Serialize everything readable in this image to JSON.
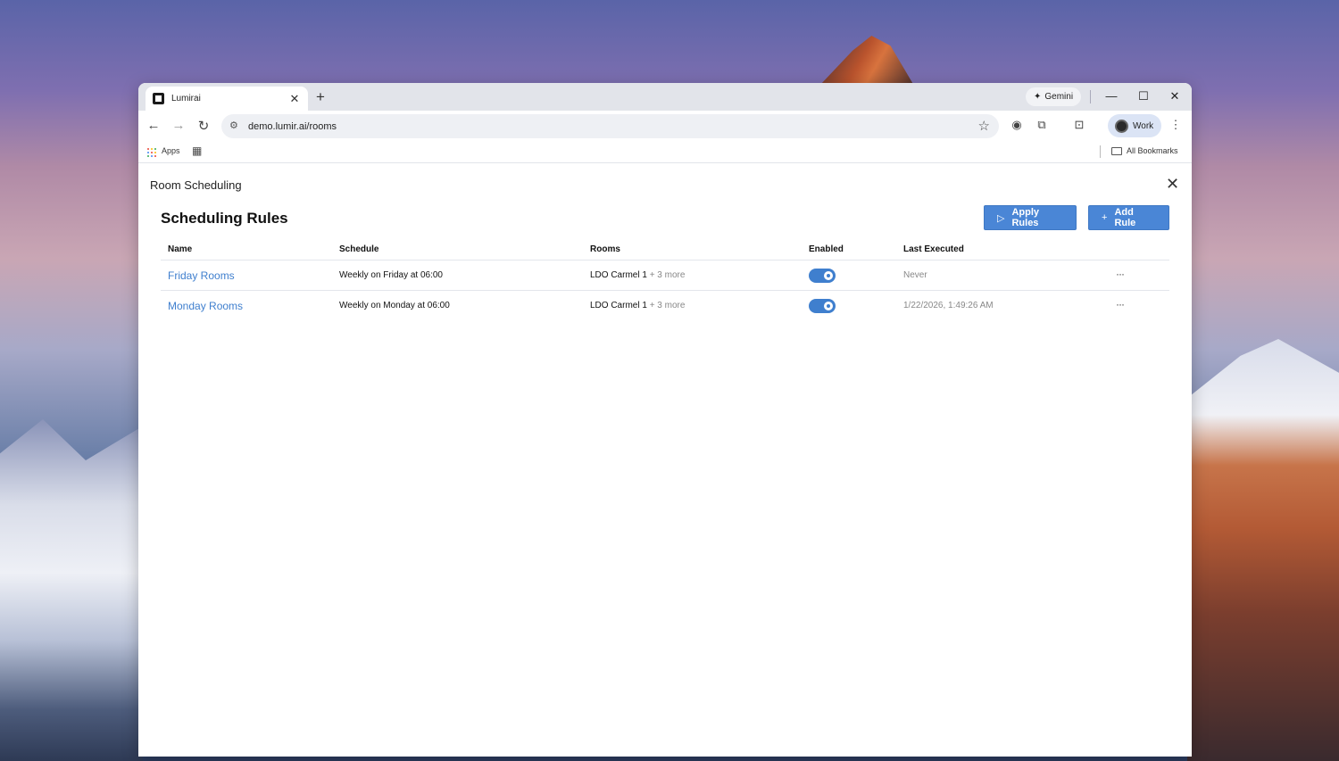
{
  "browser": {
    "tab_title": "Lumirai",
    "new_tab_icon": "plus-icon",
    "gemini_label": "Gemini",
    "url": "demo.lumir.ai/rooms",
    "profile_label": "Work",
    "bookmarks": {
      "apps_label": "Apps",
      "all_bookmarks_label": "All Bookmarks"
    },
    "app_dot_colors": [
      "#ea4335",
      "#fbbc04",
      "#34a853",
      "#4285f4",
      "#ea4335",
      "#fbbc04",
      "#34a853",
      "#4285f4",
      "#ea4335"
    ]
  },
  "app": {
    "header_title": "Room Scheduling",
    "page_title": "Scheduling Rules",
    "apply_rules_label": "Apply Rules",
    "add_rule_label": "Add Rule",
    "accent_color": "#4a86d6"
  },
  "table": {
    "columns": [
      "Name",
      "Schedule",
      "Rooms",
      "Enabled",
      "Last Executed"
    ],
    "rows": [
      {
        "name": "Friday Rooms",
        "schedule": "Weekly on Friday at 06:00",
        "rooms": "LDO Carmel 1",
        "rooms_more": "+ 3 more",
        "enabled": true,
        "last_executed": "Never"
      },
      {
        "name": "Monday Rooms",
        "schedule": "Weekly on Monday at 06:00",
        "rooms": "LDO Carmel 1",
        "rooms_more": "+ 3 more",
        "enabled": true,
        "last_executed": "1/22/2026, 1:49:26 AM"
      }
    ]
  }
}
